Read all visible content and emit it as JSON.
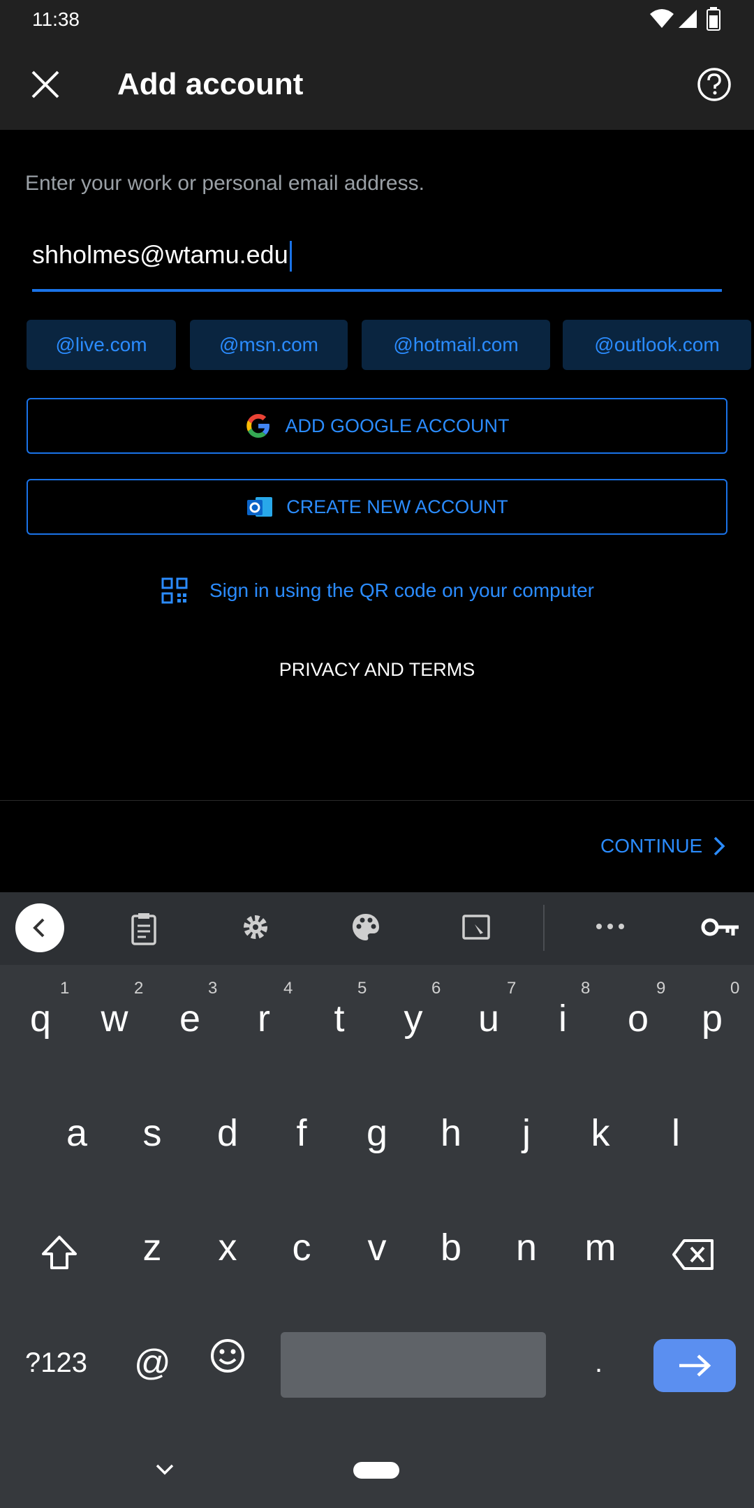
{
  "status": {
    "time": "11:38"
  },
  "header": {
    "title": "Add account"
  },
  "form": {
    "prompt": "Enter your work or personal email address.",
    "email_value": "shholmes@wtamu.edu",
    "domain_chips": [
      "@live.com",
      "@msn.com",
      "@hotmail.com",
      "@outlook.com"
    ],
    "google_button": "ADD GOOGLE ACCOUNT",
    "create_button": "CREATE NEW ACCOUNT",
    "qr_link": "Sign in using the QR code on your computer",
    "privacy": "PRIVACY AND TERMS",
    "continue": "CONTINUE"
  },
  "keyboard": {
    "row1": [
      "q",
      "w",
      "e",
      "r",
      "t",
      "y",
      "u",
      "i",
      "o",
      "p"
    ],
    "numbers": [
      "1",
      "2",
      "3",
      "4",
      "5",
      "6",
      "7",
      "8",
      "9",
      "0"
    ],
    "row2": [
      "a",
      "s",
      "d",
      "f",
      "g",
      "h",
      "j",
      "k",
      "l"
    ],
    "row3": [
      "z",
      "x",
      "c",
      "v",
      "b",
      "n",
      "m"
    ],
    "symbols": "?123",
    "at": "@",
    "period": "."
  },
  "colors": {
    "accent": "#1a73e8",
    "link": "#2b8cff",
    "bar": "#212121",
    "kb": "#36393d"
  }
}
